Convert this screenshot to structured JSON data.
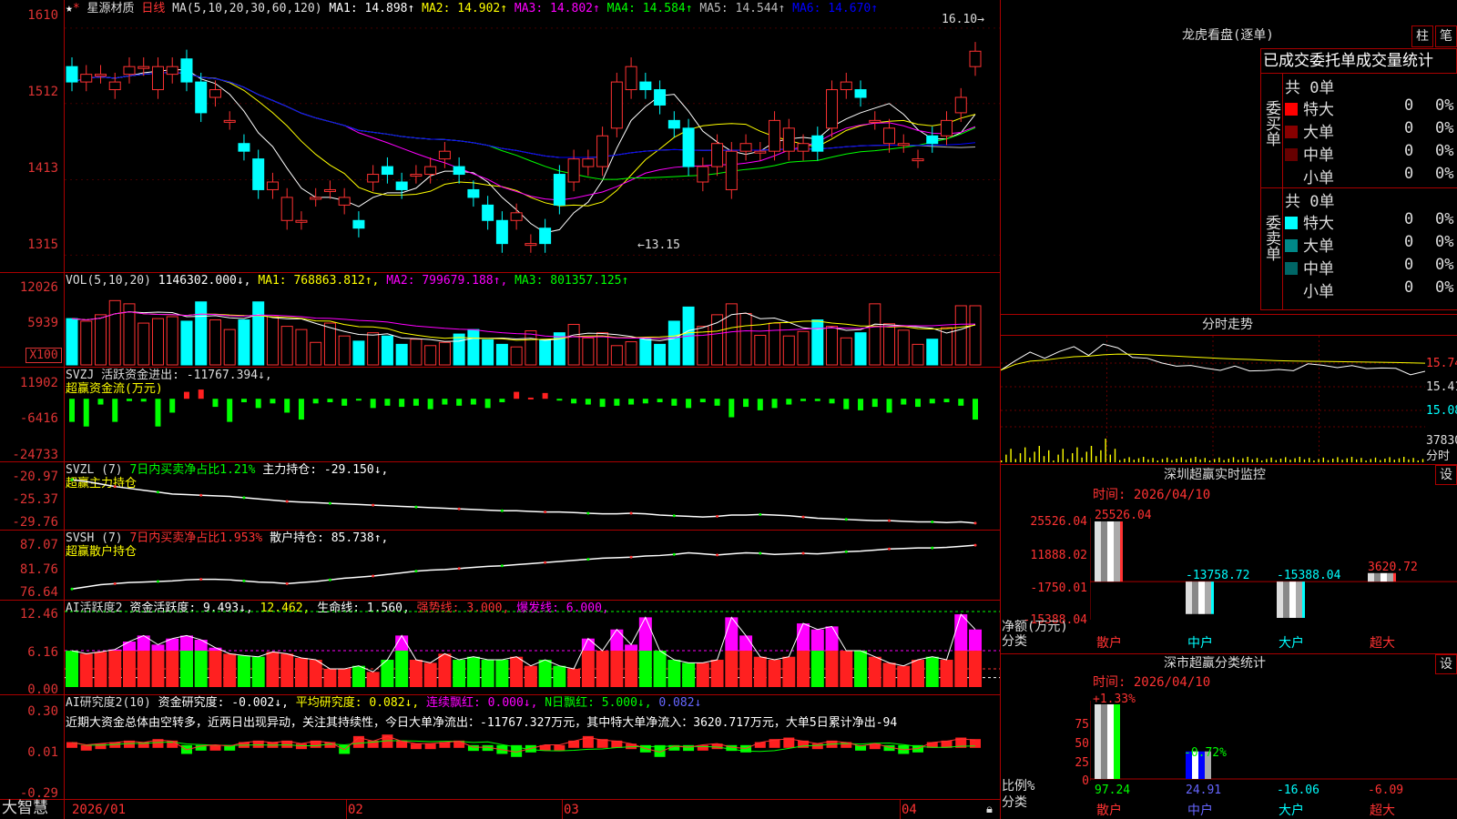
{
  "main": {
    "stock": "星源材质",
    "period": "日线",
    "ma_label": "MA(5,10,20,30,60,120)",
    "ma": [
      {
        "t": "MA1: 14.898↑",
        "c": "#ffffff"
      },
      {
        "t": "MA2: 14.902↑",
        "c": "#ffff00"
      },
      {
        "t": "MA3: 14.802↑",
        "c": "#ff00ff"
      },
      {
        "t": "MA4: 14.584↑",
        "c": "#00ff00"
      },
      {
        "t": "MA5: 14.544↑",
        "c": "#bbbbbb"
      },
      {
        "t": "MA6: 14.670↑",
        "c": "#0000ff"
      }
    ],
    "y_ticks": [
      "1610",
      "1512",
      "1413",
      "1315"
    ],
    "high_label": "16.10",
    "low_label": "←13.15"
  },
  "vol": {
    "title": "VOL(5,10,20)",
    "value": "1146302.000↓,",
    "ma1": "MA1: 768863.812↑,",
    "ma2": "MA2: 799679.188↑,",
    "ma3": "MA3: 801357.125↑",
    "y_ticks": [
      "12026",
      "5939"
    ],
    "unit": "X100"
  },
  "svzj": {
    "title": "SVZJ  活跃资金进出: -11767.394↓,",
    "sub": "超赢资金流(万元)",
    "y_ticks": [
      "11902",
      "-6416",
      "-24733"
    ]
  },
  "svzl": {
    "title": "SVZL (7)",
    "mid": "7日内买卖净占比1.21%",
    "tail": "主力持仓: -29.150↓,",
    "sub": "超赢主力持仓",
    "y_ticks": [
      "-20.97",
      "-25.37",
      "-29.76"
    ]
  },
  "svsh": {
    "title": "SVSH (7)",
    "mid": "7日内买卖净占比1.953%",
    "tail": "散户持仓: 85.738↑,",
    "sub": "超赢散户持仓",
    "y_ticks": [
      "87.07",
      "81.76",
      "76.64"
    ]
  },
  "ai1": {
    "title": "AI活跃度2",
    "p1": "资金活跃度: 9.493↓,",
    "p2": "12.462,",
    "p3": "生命线: 1.560,",
    "p4": "强势线: 3.000,",
    "p5": "爆发线: 6.000,",
    "y_ticks": [
      "12.46",
      "6.16",
      "0.00"
    ]
  },
  "ai2": {
    "title": "AI研究度2(10)",
    "p1": "资金研究度: -0.002↓,",
    "p2": "平均研究度: 0.082↓,",
    "p3": "连续飘红: 0.000↓,",
    "p4": "N日飘红: 5.000↓,",
    "p5": "0.082↓",
    "note": "近期大资金总体由空转多，近两日出现异动，关注其持续性，今日大单净流出：-11767.327万元，其中特大单净流入：3620.717万元，大单5日累计净出-94",
    "y_ticks": [
      "0.30",
      "0.01",
      "-0.29"
    ]
  },
  "x_axis": {
    "labels": [
      "2026/01",
      "02",
      "03",
      "04"
    ]
  },
  "brand": "大智慧",
  "lhb": {
    "title": "龙虎看盘(逐单)",
    "btn1": "柱",
    "btn2": "笔",
    "tabs": [
      "已成交委托单",
      "成交量统计"
    ],
    "buy": {
      "label": "委买单",
      "total": "共 0单",
      "rows": [
        {
          "n": "特大",
          "v": "0",
          "p": "0%",
          "c": "#ff0000"
        },
        {
          "n": "大单",
          "v": "0",
          "p": "0%",
          "c": "#880000"
        },
        {
          "n": "中单",
          "v": "0",
          "p": "0%",
          "c": "#660000"
        },
        {
          "n": "小单",
          "v": "0",
          "p": "0%",
          "c": "#000000"
        }
      ]
    },
    "sell": {
      "label": "委卖单",
      "total": "共 0单",
      "rows": [
        {
          "n": "特大",
          "v": "0",
          "p": "0%",
          "c": "#00ffff"
        },
        {
          "n": "大单",
          "v": "0",
          "p": "0%",
          "c": "#008888"
        },
        {
          "n": "中单",
          "v": "0",
          "p": "0%",
          "c": "#006666"
        },
        {
          "n": "小单",
          "v": "0",
          "p": "0%",
          "c": "#000000"
        }
      ]
    }
  },
  "intraday": {
    "title": "分时走势",
    "y": [
      "15.74",
      "15.41",
      "15.08",
      "37830"
    ],
    "unit": "分时"
  },
  "monitor": {
    "title": "深圳超赢实时监控",
    "btn": "设",
    "time": "时间: 2026/04/10",
    "y": [
      "25526.04",
      "11888.02",
      "-1750.01",
      "-15388.04"
    ],
    "ylabel": "净额(万元)",
    "xlabel": "分类",
    "bars": [
      {
        "cat": "散户",
        "v": "25526.04"
      },
      {
        "cat": "中户",
        "v": "-13758.72"
      },
      {
        "cat": "大户",
        "v": "-15388.04"
      },
      {
        "cat": "超大",
        "v": "3620.72"
      }
    ]
  },
  "stat": {
    "title": "深市超赢分类统计",
    "btn": "设",
    "time": "时间: 2026/04/10",
    "y": [
      "75",
      "50",
      "25",
      "0"
    ],
    "ylabel": "比例%",
    "xlabel": "分类",
    "top": [
      "+1.33%",
      "-0.72%"
    ],
    "bars": [
      {
        "cat": "散户",
        "v": "97.24"
      },
      {
        "cat": "中户",
        "v": "24.91"
      },
      {
        "cat": "大户",
        "v": "-16.06"
      },
      {
        "cat": "超大",
        "v": "-6.09"
      }
    ]
  },
  "chart_data": [
    {
      "type": "candlestick",
      "title": "星源材质 日线",
      "ylim": [
        13.0,
        16.3
      ],
      "x": [
        "2026-01-05",
        "2026-01-06",
        "2026-01-07",
        "2026-01-08",
        "2026-01-09",
        "2026-01-12",
        "2026-01-13",
        "2026-01-14",
        "2026-01-15",
        "2026-01-16",
        "2026-01-19",
        "2026-01-20",
        "2026-01-21",
        "2026-01-22",
        "2026-01-23",
        "2026-01-26",
        "2026-01-27",
        "2026-01-28",
        "2026-01-29",
        "2026-01-30",
        "2026-02-02",
        "2026-02-03",
        "2026-02-04",
        "2026-02-05",
        "2026-02-06",
        "2026-02-09",
        "2026-02-10",
        "2026-02-11",
        "2026-02-12",
        "2026-02-13",
        "2026-02-24",
        "2026-02-25",
        "2026-02-26",
        "2026-02-27",
        "2026-03-02",
        "2026-03-03",
        "2026-03-04",
        "2026-03-05",
        "2026-03-06",
        "2026-03-09",
        "2026-03-10",
        "2026-03-11",
        "2026-03-12",
        "2026-03-13",
        "2026-03-16",
        "2026-03-17",
        "2026-03-18",
        "2026-03-19",
        "2026-03-20",
        "2026-03-23",
        "2026-03-24",
        "2026-03-25",
        "2026-03-26",
        "2026-03-27",
        "2026-03-30",
        "2026-03-31",
        "2026-04-01",
        "2026-04-02",
        "2026-04-03",
        "2026-04-06",
        "2026-04-07",
        "2026-04-08",
        "2026-04-09",
        "2026-04-10"
      ],
      "open": [
        15.6,
        15.4,
        15.5,
        15.3,
        15.5,
        15.6,
        15.3,
        15.5,
        15.7,
        15.4,
        15.2,
        14.9,
        14.6,
        14.4,
        14.0,
        13.6,
        13.6,
        13.9,
        14.0,
        13.8,
        13.6,
        14.1,
        14.3,
        14.1,
        14.2,
        14.2,
        14.4,
        14.3,
        14.0,
        13.8,
        13.6,
        13.6,
        13.3,
        13.5,
        14.2,
        14.1,
        14.3,
        14.3,
        14.8,
        15.3,
        15.4,
        15.3,
        14.9,
        14.8,
        14.1,
        14.3,
        14.0,
        14.5,
        14.5,
        14.5,
        14.5,
        14.5,
        14.7,
        14.8,
        15.3,
        15.3,
        14.9,
        14.6,
        14.6,
        14.4,
        14.7,
        14.7,
        15.0,
        15.6
      ],
      "close": [
        15.4,
        15.5,
        15.5,
        15.4,
        15.6,
        15.6,
        15.6,
        15.6,
        15.4,
        15.0,
        15.3,
        14.9,
        14.5,
        14.0,
        14.1,
        13.9,
        13.6,
        13.9,
        14.0,
        13.9,
        13.5,
        14.2,
        14.2,
        14.0,
        14.2,
        14.3,
        14.5,
        14.2,
        13.9,
        13.6,
        13.3,
        13.7,
        13.3,
        13.3,
        13.8,
        14.4,
        14.4,
        14.7,
        15.4,
        15.6,
        15.3,
        15.1,
        14.8,
        14.3,
        14.3,
        14.6,
        14.5,
        14.6,
        14.5,
        14.9,
        14.8,
        14.6,
        14.5,
        15.3,
        15.4,
        15.2,
        14.9,
        14.8,
        14.6,
        14.4,
        14.6,
        14.9,
        15.2,
        15.8
      ],
      "note": "approximate daily OHLC read from candles"
    },
    {
      "type": "bar",
      "title": "VOL(5,10,20)",
      "unit": "X100",
      "ylim": [
        0,
        12026
      ],
      "values": [
        7200,
        6800,
        7800,
        10000,
        9500,
        6500,
        7200,
        7500,
        6800,
        9800,
        7000,
        5500,
        7000,
        9800,
        7500,
        6000,
        5500,
        3500,
        6500,
        4500,
        3700,
        5000,
        4500,
        3200,
        4000,
        3000,
        3500,
        4800,
        5500,
        3900,
        3200,
        2800,
        5300,
        3900,
        5000,
        6300,
        4200,
        5000,
        3000,
        3600,
        4000,
        3200,
        6800,
        9000,
        6000,
        7800,
        9500,
        8000,
        4600,
        6500,
        4500,
        5200,
        7000,
        6000,
        4200,
        5000,
        9500,
        6400,
        5400,
        3200,
        4000,
        5800,
        9200,
        9200
      ]
    },
    {
      "type": "bar",
      "title": "SVZJ",
      "ylim": [
        -24733,
        11902
      ],
      "values": [
        -10000,
        -12000,
        -2500,
        -10000,
        -1000,
        -1200,
        -12000,
        -6000,
        3000,
        4000,
        -3500,
        -10000,
        -1500,
        -4000,
        -2000,
        -6000,
        -9000,
        -2000,
        -1500,
        -3000,
        -500,
        -4000,
        -3000,
        -3500,
        -3000,
        -4500,
        -2500,
        -3000,
        -2500,
        -4000,
        -1500,
        3000,
        500,
        2500,
        -300,
        -2000,
        -2500,
        -3500,
        -3000,
        -2500,
        -2000,
        -1500,
        -3000,
        -4000,
        -1500,
        -3000,
        -8000,
        -3500,
        -5000,
        -4000,
        -2500,
        -1000,
        -1000,
        -2000,
        -4500,
        -5000,
        -3500,
        -6000,
        -2500,
        -3500,
        -2000,
        -1500,
        -3000,
        -9000
      ]
    },
    {
      "type": "line",
      "title": "SVZL",
      "ylim": [
        -29.76,
        -20.97
      ],
      "values": [
        -22.6,
        -22.9,
        -23.3,
        -23.7,
        -24.0,
        -24.3,
        -24.6,
        -24.9,
        -25.0,
        -25.1,
        -25.2,
        -25.3,
        -25.5,
        -25.7,
        -25.9,
        -26.1,
        -26.2,
        -26.3,
        -26.4,
        -26.5,
        -26.6,
        -26.7,
        -26.8,
        -26.9,
        -27.0,
        -27.1,
        -27.2,
        -27.3,
        -27.4,
        -27.5,
        -27.6,
        -27.6,
        -27.7,
        -27.8,
        -27.8,
        -27.9,
        -28.0,
        -28.1,
        -28.1,
        -28.0,
        -28.1,
        -28.3,
        -28.4,
        -28.5,
        -28.6,
        -28.5,
        -28.3,
        -28.3,
        -28.2,
        -28.3,
        -28.4,
        -28.6,
        -28.8,
        -28.9,
        -29.0,
        -29.1,
        -29.2,
        -29.2,
        -29.3,
        -29.4,
        -29.4,
        -29.5,
        -29.4,
        -29.6
      ]
    },
    {
      "type": "line",
      "title": "SVSH",
      "ylim": [
        76.64,
        87.07
      ],
      "values": [
        77.6,
        78.0,
        78.4,
        78.6,
        78.8,
        78.9,
        79.0,
        79.1,
        79.3,
        79.4,
        79.4,
        79.3,
        79.1,
        78.9,
        78.8,
        78.6,
        78.8,
        79.0,
        79.3,
        79.6,
        79.8,
        80.0,
        80.3,
        80.6,
        80.9,
        81.1,
        81.2,
        81.4,
        81.6,
        81.8,
        81.9,
        82.1,
        82.3,
        82.5,
        82.7,
        82.9,
        83.1,
        83.3,
        83.4,
        83.5,
        83.7,
        83.8,
        84.0,
        84.3,
        84.1,
        83.9,
        84.1,
        84.3,
        84.2,
        84.0,
        84.1,
        84.2,
        84.1,
        84.3,
        84.5,
        84.6,
        84.8,
        85.0,
        85.1,
        85.2,
        85.2,
        85.3,
        85.5,
        85.7
      ]
    },
    {
      "type": "bar",
      "title": "AI活跃度2",
      "ylim": [
        0,
        12.46
      ],
      "values": [
        6.0,
        5.5,
        5.8,
        6.2,
        7.5,
        8.5,
        7.0,
        8.0,
        8.5,
        7.8,
        6.5,
        5.5,
        5.2,
        5.0,
        5.8,
        5.5,
        4.8,
        4.5,
        3.0,
        3.0,
        3.5,
        2.5,
        4.5,
        8.5,
        4.5,
        4.0,
        5.5,
        4.5,
        5.0,
        4.5,
        4.5,
        5.0,
        3.5,
        4.5,
        3.5,
        3.0,
        8.0,
        6.0,
        9.5,
        7.0,
        11.5,
        6.0,
        4.5,
        4.0,
        4.0,
        4.5,
        11.5,
        8.5,
        5.0,
        4.5,
        5.0,
        10.5,
        9.5,
        10.0,
        6.0,
        6.0,
        5.0,
        4.0,
        3.5,
        4.5,
        5.0,
        4.5,
        12.0,
        9.5
      ]
    },
    {
      "type": "bar",
      "title": "AI研究度2(10)",
      "ylim": [
        -0.29,
        0.3
      ],
      "values": [
        0.02,
        0.0,
        0.01,
        0.02,
        0.03,
        0.02,
        0.04,
        0.03,
        -0.04,
        -0.01,
        0.0,
        -0.01,
        0.02,
        0.03,
        0.02,
        0.03,
        0.01,
        0.03,
        0.02,
        -0.04,
        0.06,
        0.03,
        0.07,
        0.03,
        0.01,
        0.01,
        0.02,
        0.03,
        -0.02,
        -0.02,
        -0.04,
        -0.06,
        -0.03,
        0.0,
        0.0,
        0.03,
        0.06,
        0.04,
        0.03,
        0.01,
        -0.03,
        -0.06,
        -0.01,
        -0.02,
        0.0,
        0.01,
        -0.02,
        -0.03,
        0.02,
        0.04,
        0.05,
        0.03,
        0.01,
        0.03,
        0.02,
        -0.01,
        0.01,
        -0.02,
        -0.04,
        -0.03,
        0.02,
        0.03,
        0.05,
        0.04
      ]
    },
    {
      "type": "line",
      "title": "分时走势",
      "ylim": [
        15.0,
        15.9
      ],
      "values": [
        15.58,
        15.7,
        15.74,
        15.72,
        15.78,
        15.8,
        15.76,
        15.84,
        15.8,
        15.74,
        15.68,
        15.66,
        15.64,
        15.6,
        15.62,
        15.58,
        15.6,
        15.6,
        15.56,
        15.58,
        15.6,
        15.62,
        15.64,
        15.62,
        15.6,
        15.62,
        15.6,
        15.58,
        15.56,
        15.55
      ]
    },
    {
      "type": "bar",
      "title": "深圳超赢实时监控",
      "categories": [
        "散户",
        "中户",
        "大户",
        "超大"
      ],
      "values": [
        25526.04,
        -13758.72,
        -15388.04,
        3620.72
      ],
      "ylim": [
        -15388.04,
        25526.04
      ]
    },
    {
      "type": "bar",
      "title": "深市超赢分类统计",
      "categories": [
        "散户",
        "中户",
        "大户",
        "超大"
      ],
      "values": [
        97.24,
        24.91,
        -16.06,
        -6.09
      ],
      "ylim": [
        0,
        75
      ]
    }
  ]
}
